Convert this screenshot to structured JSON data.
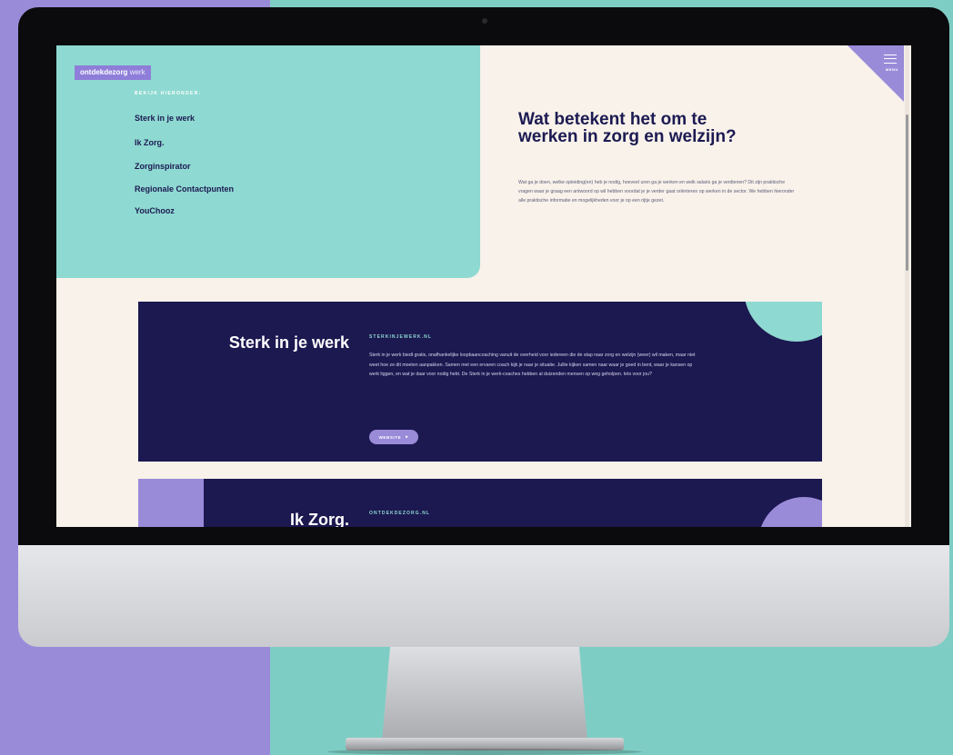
{
  "brand": {
    "logo_bold": "ontdekdezorg",
    "logo_light": "werk"
  },
  "menu": {
    "label": "MENU"
  },
  "hero": {
    "links_label": "BEKIJK HIERONDER:",
    "links": [
      "Sterk in je werk",
      "Ik Zorg.",
      "Zorginspirator",
      "Regionale Contactpunten",
      "YouChooz"
    ]
  },
  "intro": {
    "title": "Wat betekent het om te werken in zorg en welzijn?",
    "text": "Wat ga je doen, welke opleiding(en) heb je nodig, hoeveel uren ga je werken en welk salaris ga je verdienen? Dit zijn praktische vragen waar je graag een antwoord op wil hebben voordat je je verder gaat oriënteren op werken in de sector. We hebben hieronder alle praktische informatie en mogelijkheden voor je op een rijtje gezet."
  },
  "cards": [
    {
      "title": "Sterk in je werk",
      "domain": "STERKINJEWERK.NL",
      "text": "Sterk in je werk biedt gratis, onafhankelijke loopbaancoaching vanuit de overheid voor iedereen die de stap naar zorg en welzijn (weer) wil maken, maar niet weet hoe ze dit moeten aanpakken. Samen met een ervaren coach kijk je naar je situatie. Jullie kijken samen naar waar je goed in bent, waar je kansen op werk liggen, en wat je daar voor nodig hebt. De Sterk in je werk-coaches hebben al duizenden mensen op weg geholpen. Iets voor jou?",
      "button": "WEBSITE"
    },
    {
      "title": "Ik Zorg.",
      "domain": "ONTDEKDEZORG.NL"
    }
  ],
  "colors": {
    "navy": "#1c1850",
    "teal": "#8ed9d1",
    "purple": "#9a8bd9",
    "cream": "#f8f2ea"
  },
  "icons": {
    "menu": "hamburger-icon",
    "button_arrow": "play-arrow-icon"
  }
}
